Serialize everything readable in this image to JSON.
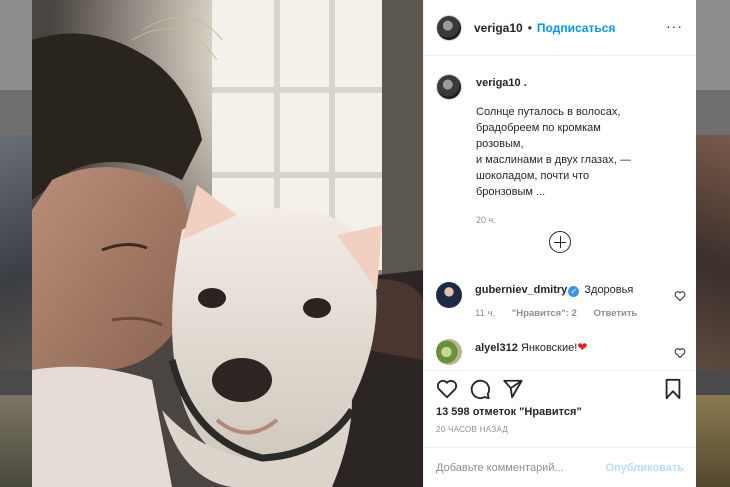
{
  "post": {
    "username": "veriga10",
    "separator": "•",
    "follow_label": "Подписаться",
    "more_label": "···"
  },
  "caption": {
    "username": "veriga10 .",
    "text": "Солнце путалось в волосах,\nбрадобреем по кромкам\nрозовым,\nи маслинами в двух глазах, —\nшоколадом, почти что\nбронзовым ...",
    "time": "20 ч."
  },
  "load_more": {
    "icon": "plus-circle-icon"
  },
  "comments": [
    {
      "username": "guberniev_dmitry",
      "verified": true,
      "verified_icon": "verified-badge-icon",
      "text": "Здоровья",
      "time": "11 ч.",
      "likes": "\"Нравится\": 2",
      "reply": "Ответить"
    },
    {
      "username": "alyel312",
      "verified": false,
      "text": "Янковские!",
      "emoji": "❤"
    }
  ],
  "actions": {
    "like_icon": "heart-icon",
    "comment_icon": "comment-icon",
    "share_icon": "paper-plane-icon",
    "save_icon": "bookmark-icon",
    "likes_text": "13 598 отметок \"Нравится\"",
    "posted_time": "20 ЧАСОВ НАЗАД"
  },
  "add_comment": {
    "placeholder": "Добавьте комментарий...",
    "publish_label": "Опубликовать"
  },
  "colors": {
    "accent": "#0095f6",
    "publish_disabled": "#b2dffc",
    "heart_red": "#ed1c24",
    "muted": "#8e8e8e"
  }
}
